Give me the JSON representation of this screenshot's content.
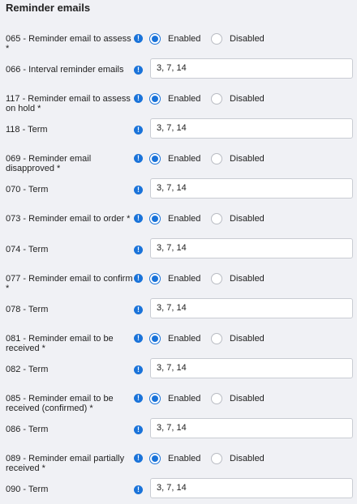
{
  "section_title": "Reminder emails",
  "info_glyph": "!",
  "settings": [
    {
      "toggle_label": "065 - Reminder email to assess *",
      "enabled_label": "Enabled",
      "disabled_label": "Disabled",
      "selected": "Enabled",
      "term_label": "066 - Interval reminder emails",
      "term_value": "3, 7, 14"
    },
    {
      "toggle_label": "117 - Reminder email to assess on hold *",
      "enabled_label": "Enabled",
      "disabled_label": "Disabled",
      "selected": "Enabled",
      "term_label": "118 - Term",
      "term_value": "3, 7, 14"
    },
    {
      "toggle_label": "069 - Reminder email disapproved *",
      "enabled_label": "Enabled",
      "disabled_label": "Disabled",
      "selected": "Enabled",
      "term_label": "070 - Term",
      "term_value": "3, 7, 14"
    },
    {
      "toggle_label": "073 - Reminder email to order *",
      "enabled_label": "Enabled",
      "disabled_label": "Disabled",
      "selected": "Enabled",
      "term_label": "074 - Term",
      "term_value": "3, 7, 14"
    },
    {
      "toggle_label": "077 - Reminder email to confirm *",
      "enabled_label": "Enabled",
      "disabled_label": "Disabled",
      "selected": "Enabled",
      "term_label": "078 - Term",
      "term_value": "3, 7, 14"
    },
    {
      "toggle_label": "081 - Reminder email to be received *",
      "enabled_label": "Enabled",
      "disabled_label": "Disabled",
      "selected": "Enabled",
      "term_label": "082 - Term",
      "term_value": "3, 7, 14"
    },
    {
      "toggle_label": "085 - Reminder email to be received (confirmed) *",
      "enabled_label": "Enabled",
      "disabled_label": "Disabled",
      "selected": "Enabled",
      "term_label": "086 - Term",
      "term_value": "3, 7, 14"
    },
    {
      "toggle_label": "089 - Reminder email partially received *",
      "enabled_label": "Enabled",
      "disabled_label": "Disabled",
      "selected": "Enabled",
      "term_label": "090 - Term",
      "term_value": "3, 7, 14"
    }
  ],
  "colors": {
    "accent": "#1a73d9",
    "background": "#f0f1f5",
    "input_border": "#c9ccd3"
  }
}
